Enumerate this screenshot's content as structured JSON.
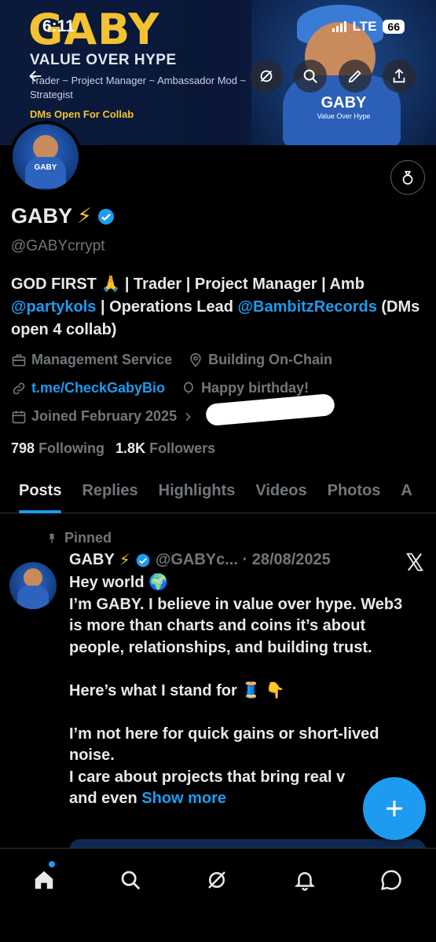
{
  "status_bar": {
    "time": "6:11",
    "network": "LTE",
    "battery": "66"
  },
  "banner": {
    "title": "GABY",
    "subtitle": "VALUE OVER HYPE",
    "roles": "Trader ~ Project Manager ~ Ambassador Mod ~ Strategist",
    "dms": "DMs Open For Collab",
    "art_text": "GABY",
    "art_subtext": "Value Over Hype"
  },
  "avatar": {
    "text": "GABY"
  },
  "profile": {
    "name": "GABY",
    "name_emoji": "⚡",
    "handle": "@GABYcrrypt",
    "bio_part1": "GOD FIRST 🙏 | Trader | Project Manager | Amb ",
    "bio_mention1": "@partykols",
    "bio_part2": " | Operations Lead ",
    "bio_mention2": "@BambitzRecords",
    "bio_part3": " (DMs open 4 collab)",
    "category": "Management Service",
    "location": "Building On-Chain",
    "link": "t.me/CheckGabyBio",
    "birthday": "Happy birthday!",
    "joined": "Joined February 2025",
    "following_count": "798",
    "following_label": "Following",
    "followers_count": "1.8K",
    "followers_label": "Followers"
  },
  "tabs": [
    "Posts",
    "Replies",
    "Highlights",
    "Videos",
    "Photos",
    "A"
  ],
  "post": {
    "pinned_label": "Pinned",
    "author": "GABY",
    "author_emoji": "⚡",
    "meta": "@GABYc... · 28/08/2025",
    "lines": [
      "Hey world 🌍",
      "I’m GABY. I believe in value over hype. Web3 is more than charts and coins it’s about people, relationships, and building trust.",
      "",
      "Here’s what I stand for 🧵 👇",
      "",
      "I’m not here for quick gains or short-lived noise.",
      "I care about projects that bring real v"
    ],
    "last_line_prefix": "and even ",
    "show_more": "Show more"
  },
  "colors": {
    "accent": "#1d9bf0",
    "banner_gold": "#f2c230",
    "muted": "#71767b"
  },
  "icons": {
    "header": [
      "back-arrow-icon",
      "grok-icon",
      "search-icon",
      "edit-icon",
      "share-icon"
    ],
    "nav": [
      "home-icon",
      "search-icon",
      "grok-icon",
      "notifications-icon",
      "messages-icon"
    ]
  }
}
